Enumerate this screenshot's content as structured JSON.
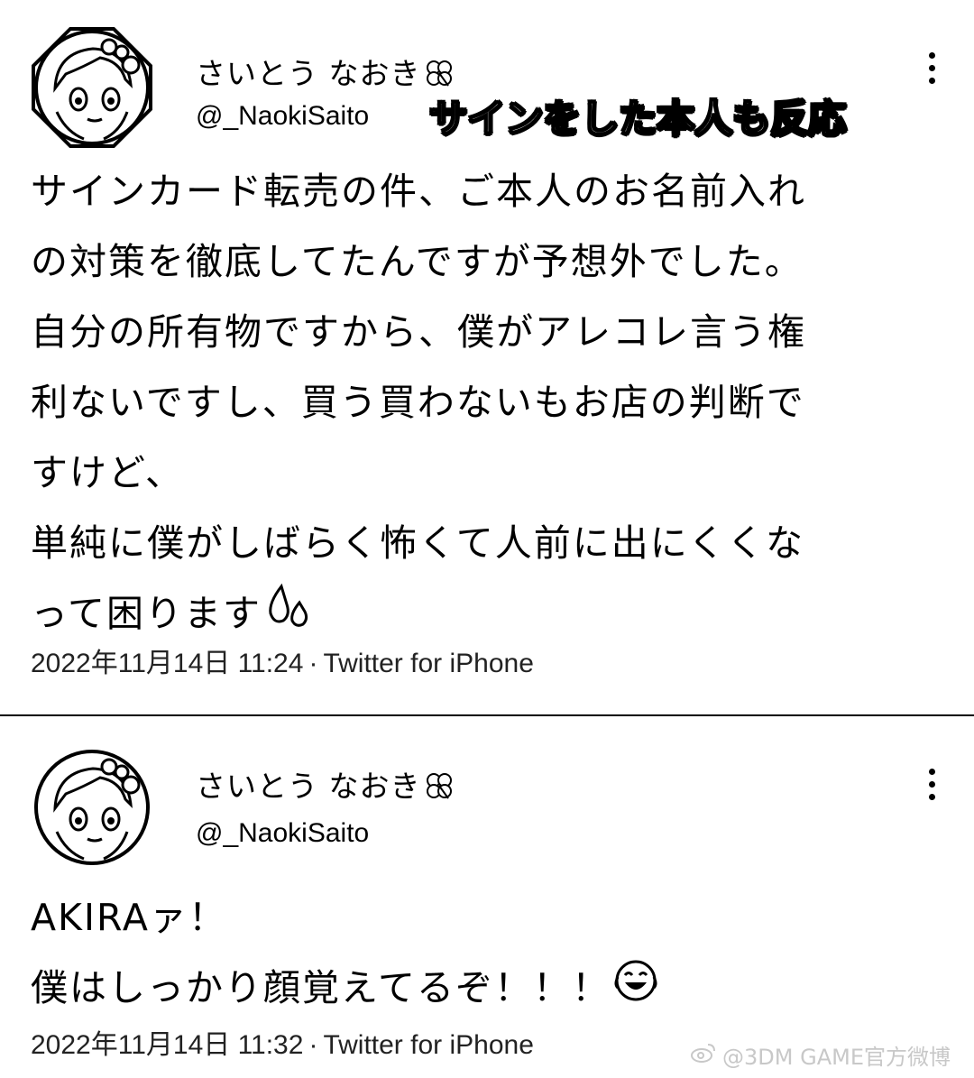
{
  "overlay_caption": "サインをした本人も反応",
  "tweets": [
    {
      "display_name": "さいとう なおき",
      "handle": "@_NaokiSaito",
      "text_lines": [
        "サインカード転売の件、ご本人のお名前入れ",
        "の対策を徹底してたんですが予想外でした。",
        "自分の所有物ですから、僕がアレコレ言う権",
        "利ないですし、買う買わないもお店の判断で",
        "すけど、",
        "単純に僕がしばらく怖くて人前に出にくくな",
        "って困ります"
      ],
      "trailing_emoji": "sweat-drops-icon",
      "timestamp": "2022年11月14日 11:24",
      "source": "Twitter for iPhone"
    },
    {
      "display_name": "さいとう なおき",
      "handle": "@_NaokiSaito",
      "text_lines": [
        "AKIRAァ！",
        "僕はしっかり顔覚えてるぞ！！！"
      ],
      "trailing_emoji": "laughing-face-icon",
      "timestamp": "2022年11月14日 11:32",
      "source": "Twitter for iPhone"
    }
  ],
  "separator": "·",
  "watermark": "@3DM GAME官方微博"
}
